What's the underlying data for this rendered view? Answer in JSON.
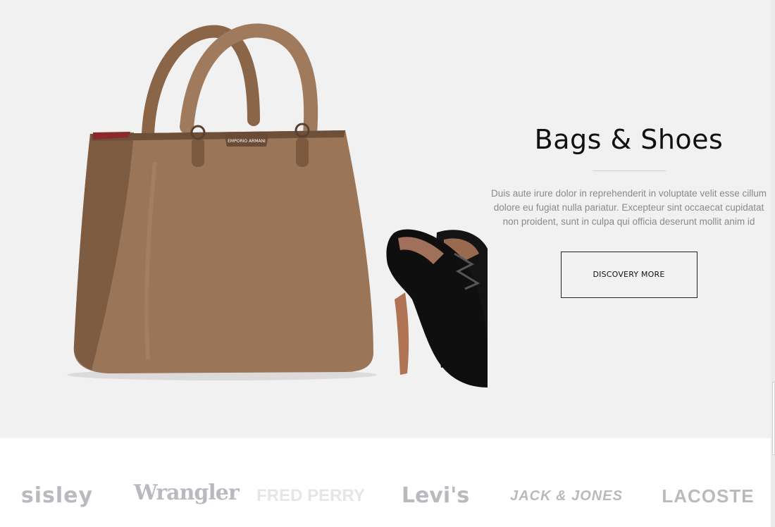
{
  "hero": {
    "title": "Bags & Shoes",
    "description": "Duis aute irure dolor in reprehenderit in voluptate velit esse cillum dolore eu fugiat nulla pariatur. Excepteur sint occaecat cupidatat non proident, sunt in culpa qui officia deserunt mollit anim id",
    "cta_label": "DISCOVERY MORE",
    "bag_label": "EMPORIO ARMANI",
    "images": [
      "handbag-image",
      "heels-image"
    ]
  },
  "brands": [
    {
      "name": "sisley"
    },
    {
      "name": "Wrangler"
    },
    {
      "name": "FRED PERRY"
    },
    {
      "name": "Levi's"
    },
    {
      "name": "JACK & JONES"
    },
    {
      "name": "LACOSTE"
    }
  ],
  "colors": {
    "hero_bg": "#f2f1f1",
    "title": "#111111",
    "text": "#8a8a8a",
    "brand_logo": "#b9b9bf",
    "bag": "#9b7558",
    "heel": "#0f0f0f"
  }
}
